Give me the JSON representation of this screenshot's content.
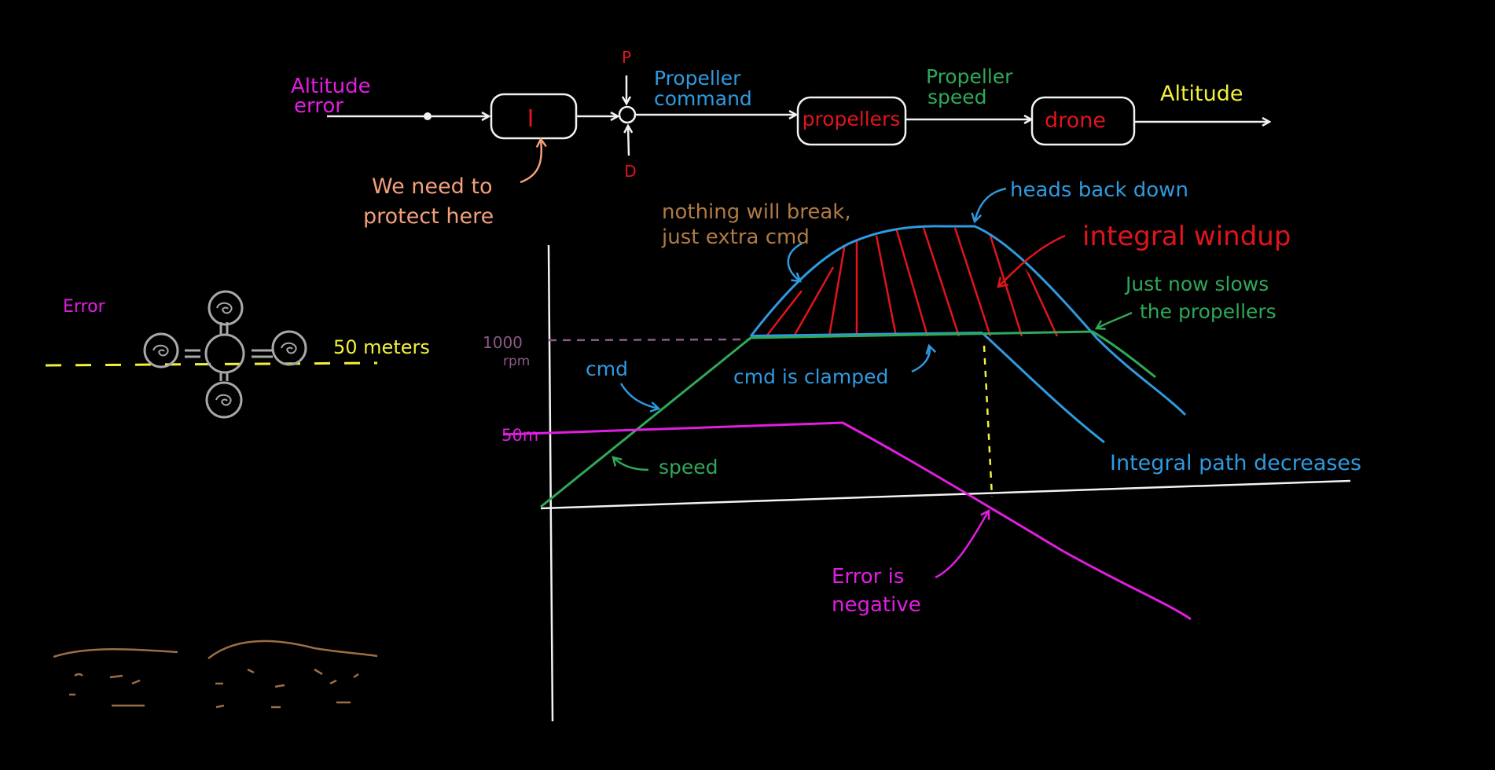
{
  "colors": {
    "background": "#000000",
    "white": "#f2f2f2",
    "magenta": "#e01ee0",
    "blue": "#2f9ae0",
    "green": "#2fa858",
    "red": "#e0151b",
    "yellow": "#f2f23a",
    "orange": "#f2a07a",
    "brown": "#b07a45",
    "purple_dash": "#8a5a8a",
    "gray": "#9a9a9a"
  },
  "block_diagram": {
    "input_label_1": "Altitude",
    "input_label_2": "error",
    "integrator_label": "I",
    "p_label": "P",
    "d_label": "D",
    "propeller_command_1": "Propeller",
    "propeller_command_2": "command",
    "propellers_block": "propellers",
    "propeller_speed_1": "Propeller",
    "propeller_speed_2": "speed",
    "drone_block": "drone",
    "output_label": "Altitude",
    "protect_note_1": "We need to",
    "protect_note_2": "protect here"
  },
  "scene": {
    "error_label": "Error",
    "target_label": "50 meters"
  },
  "plot": {
    "rpm_tick_1": "1000",
    "rpm_tick_2": "rpm",
    "altitude_tick": "50m",
    "cmd_label": "cmd",
    "speed_label": "speed",
    "clamped_label": "cmd is clamped",
    "nothing_break_1": "nothing will break,",
    "nothing_break_2": "just extra cmd",
    "heads_back": "heads back down",
    "windup_label": "integral windup",
    "slows_1": "Just now slows",
    "slows_2": "the propellers",
    "integral_decreases": "Integral path decreases",
    "error_negative_1": "Error is",
    "error_negative_2": "negative"
  }
}
